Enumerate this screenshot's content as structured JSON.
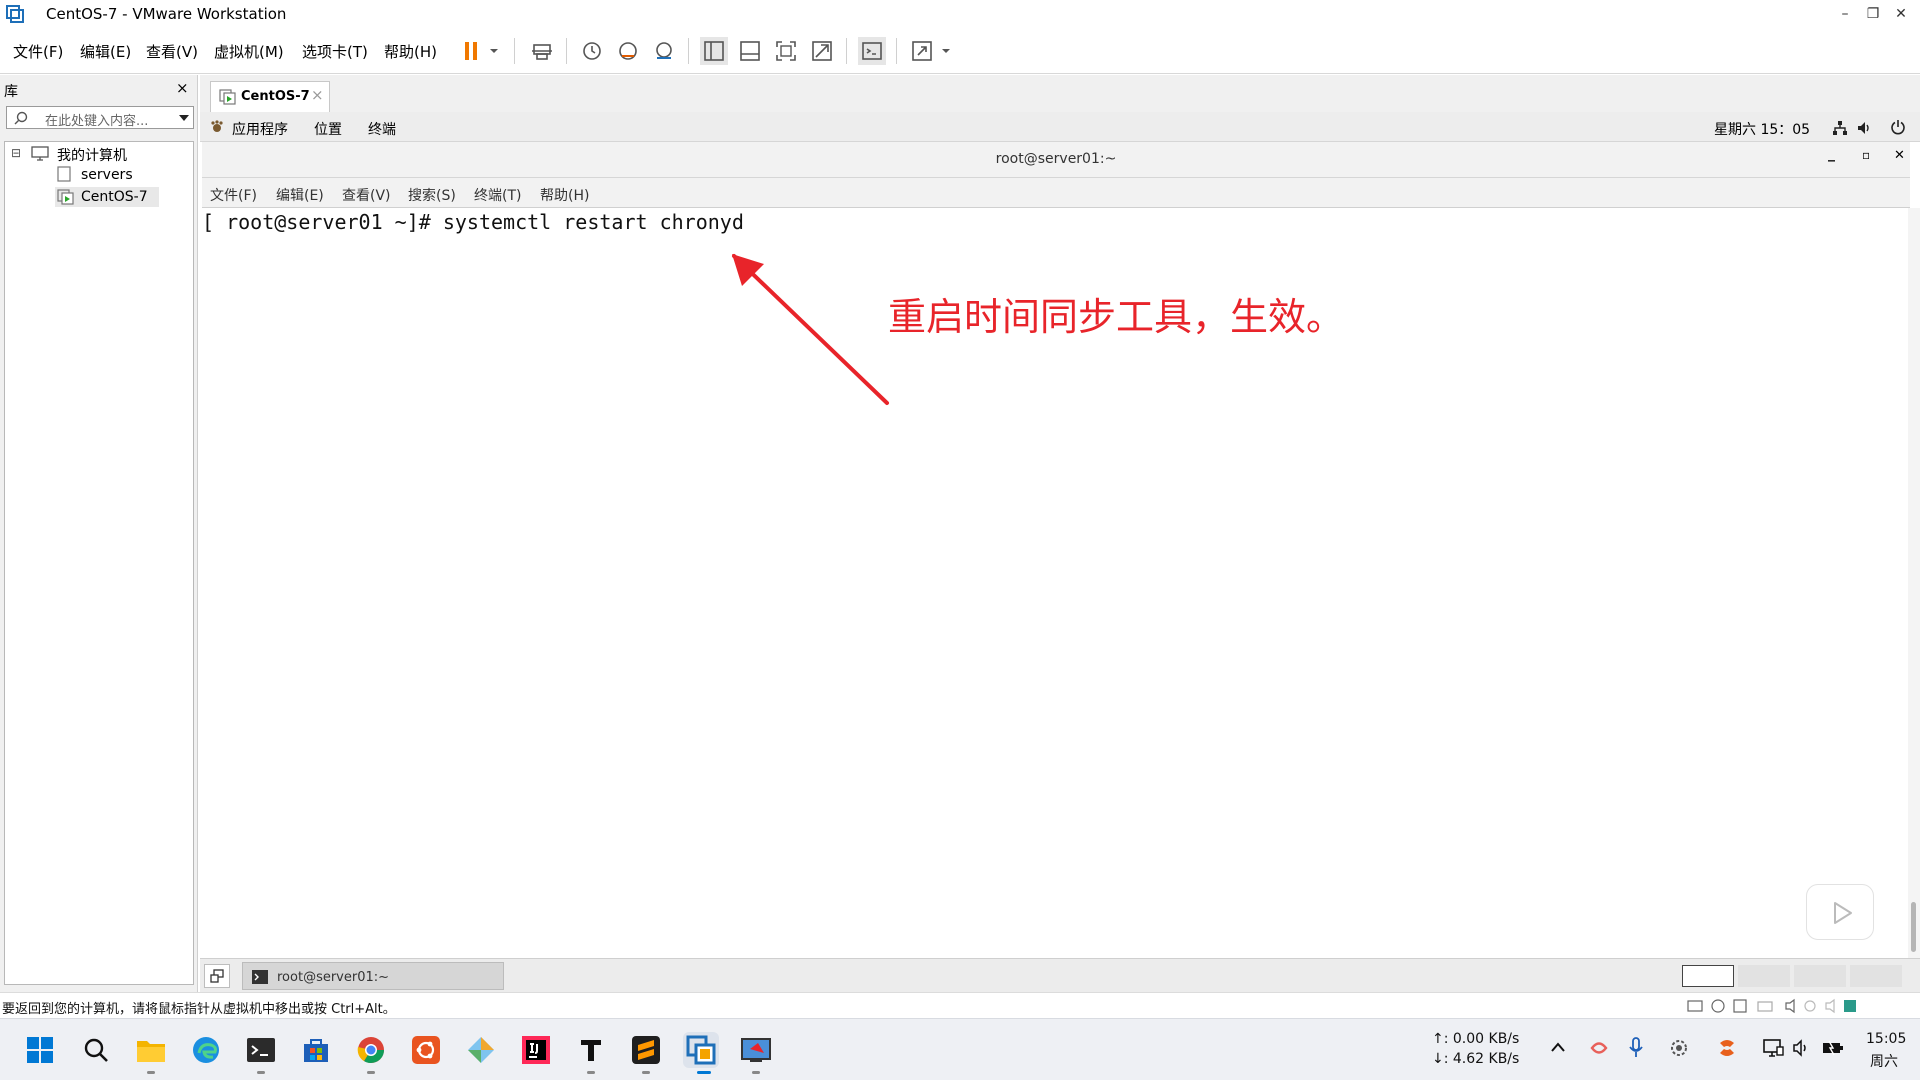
{
  "window": {
    "title": "CentOS-7 - VMware Workstation",
    "controls": [
      "–",
      "❐",
      "✕"
    ]
  },
  "menu": [
    "文件(F)",
    "编辑(E)",
    "查看(V)",
    "虚拟机(M)",
    "选项卡(T)",
    "帮助(H)"
  ],
  "library": {
    "title": "库",
    "close": "×",
    "search_placeholder": "在此处键入内容...",
    "tree": [
      {
        "label": "我的计算机",
        "expander": "⊟"
      },
      {
        "label": "servers"
      },
      {
        "label": "CentOS-7"
      }
    ]
  },
  "vm_tab": {
    "label": "CentOS-7",
    "close": "×"
  },
  "gnome_bar": {
    "applications": "应用程序",
    "places": "位置",
    "terminal": "终端",
    "clock": "星期六 15：05"
  },
  "terminal": {
    "title": "root@server01:~",
    "menu": [
      "文件(F)",
      "编辑(E)",
      "查看(V)",
      "搜索(S)",
      "终端(T)",
      "帮助(H)"
    ],
    "prompt": "[ root@server01 ~]# ",
    "command": "systemctl restart chronyd",
    "annotation": "重启时间同步工具，生效。",
    "annotation_color": "#e8242a",
    "controls": [
      "_",
      "▫",
      "✕"
    ]
  },
  "gnome_taskbar": {
    "item": "root@server01:~"
  },
  "status_bar": {
    "message": "要返回到您的计算机，请将鼠标指针从虚拟机中移出或按 Ctrl+Alt。"
  },
  "win_taskbar": {
    "net_up": "↑: 0.00 KB/s",
    "net_down": "↓: 4.62 KB/s",
    "time": "15:05",
    "day": "周六"
  },
  "colors": {
    "accent_orange": "#f07800",
    "windows_blue": "#0078d4"
  }
}
